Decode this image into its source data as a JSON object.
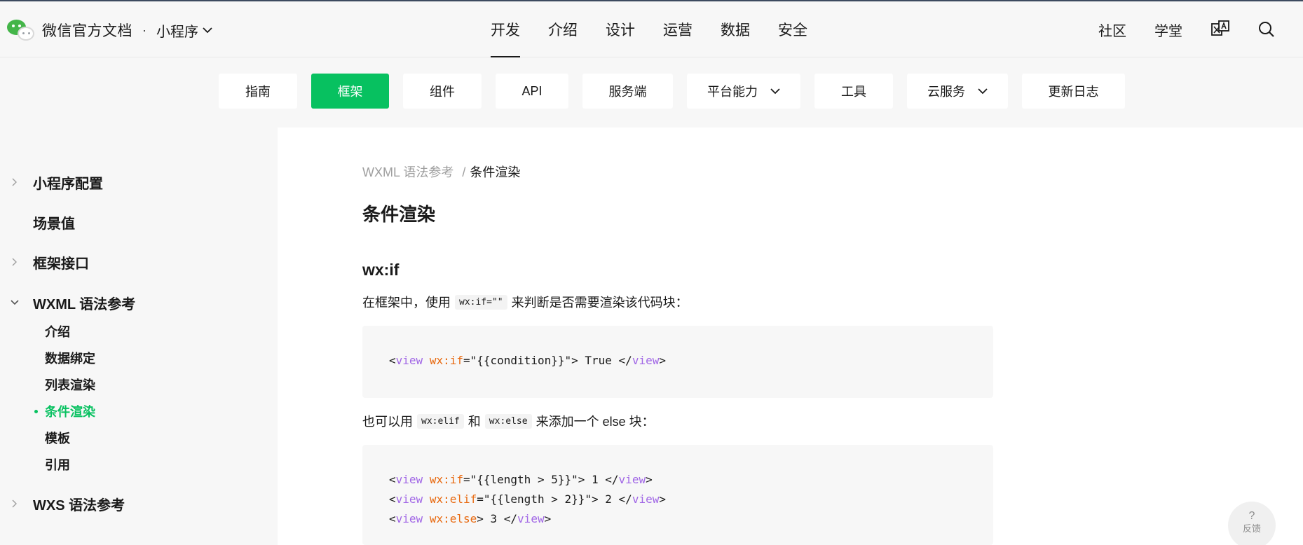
{
  "header": {
    "brand_title": "微信官方文档",
    "brand_dot": "·",
    "brand_sub": "小程序",
    "main_nav": [
      "开发",
      "介绍",
      "设计",
      "运营",
      "数据",
      "安全"
    ],
    "right_links": [
      "社区",
      "学堂"
    ],
    "icons": [
      "translate-icon",
      "search-icon"
    ]
  },
  "tabs": [
    {
      "label": "指南"
    },
    {
      "label": "框架",
      "active": true
    },
    {
      "label": "组件"
    },
    {
      "label": "API"
    },
    {
      "label": "服务端"
    },
    {
      "label": "平台能力",
      "dropdown": true
    },
    {
      "label": "工具"
    },
    {
      "label": "云服务",
      "dropdown": true
    },
    {
      "label": "更新日志"
    }
  ],
  "sidebar": {
    "items": [
      {
        "label": "小程序配置",
        "arrow": "right"
      },
      {
        "label": "场景值",
        "arrow": "none"
      },
      {
        "label": "框架接口",
        "arrow": "right"
      },
      {
        "label": "WXML 语法参考",
        "arrow": "down"
      },
      {
        "label": "WXS 语法参考",
        "arrow": "right"
      }
    ],
    "subitems": [
      "介绍",
      "数据绑定",
      "列表渲染",
      "条件渲染",
      "模板",
      "引用"
    ],
    "current": "条件渲染"
  },
  "content": {
    "breadcrumb_parent": "WXML 语法参考",
    "breadcrumb_sep": "/",
    "breadcrumb_current": "条件渲染",
    "title": "条件渲染",
    "section_title": "wx:if",
    "para1_before": "在框架中，使用",
    "para1_code": "wx:if=\"\"",
    "para1_after": "来判断是否需要渲染该代码块：",
    "code1": "<view wx:if=\"{{condition}}\"> True </view>",
    "para2_before": "也可以用",
    "para2_code1": "wx:elif",
    "para2_mid": "和",
    "para2_code2": "wx:else",
    "para2_after": "来添加一个 else 块：",
    "code2": [
      "<view wx:if=\"{{length > 5}}\"> 1 </view>",
      "<view wx:elif=\"{{length > 2}}\"> 2 </view>",
      "<view wx:else> 3 </view>"
    ]
  },
  "feedback": {
    "icon": "?",
    "label": "反馈"
  },
  "colors": {
    "accent": "#07c160",
    "code_tag": "#a167e6",
    "code_attr": "#e8690f"
  }
}
